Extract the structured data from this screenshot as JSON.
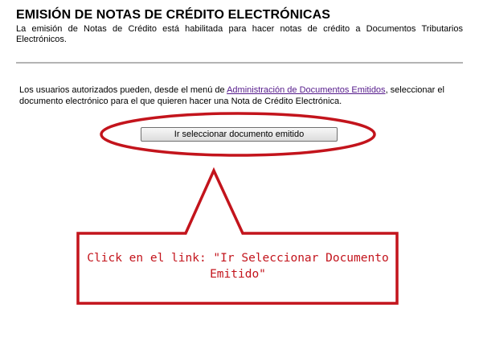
{
  "page": {
    "title": "EMISIÓN DE NOTAS DE CRÉDITO ELECTRÓNICAS",
    "description": "La emisión de Notas de Crédito está habilitada para hacer notas de crédito a Documentos Tributarios Electrónicos."
  },
  "instructions": {
    "text_before_link": "Los usuarios autorizados pueden, desde el menú de ",
    "link_label": "Administración de Documentos Emitidos",
    "text_after_link": ", seleccionar el documento electrónico para el que quieren hacer una Nota de Crédito Electrónica."
  },
  "actions": {
    "select_document_button_label": "Ir seleccionar documento emitido"
  },
  "annotation": {
    "callout_line1": "Click en el link: \"Ir Seleccionar Documento",
    "callout_line2": "Emitido\"",
    "color": "#c3141c"
  },
  "colors": {
    "link": "#551a8b",
    "divider": "#b4b4b4"
  }
}
